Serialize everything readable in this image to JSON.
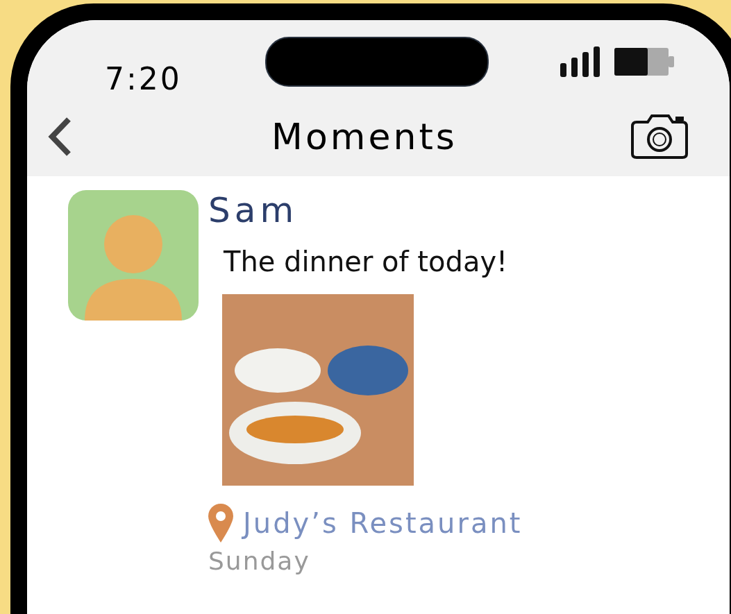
{
  "status_bar": {
    "time": "7:20"
  },
  "nav": {
    "title": "Moments"
  },
  "post": {
    "author": "Sam",
    "text": "The dinner of today!",
    "location": "Judy’s Restaurant",
    "day": "Sunday"
  }
}
